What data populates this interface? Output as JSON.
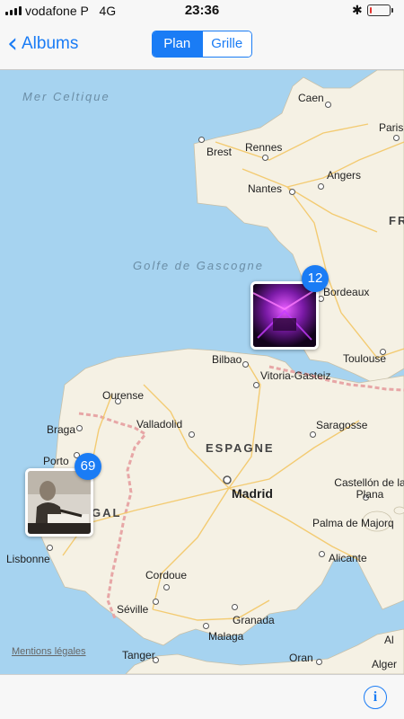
{
  "status_bar": {
    "carrier": "vodafone P",
    "network": "4G",
    "time": "23:36",
    "battery_level": 0.12,
    "battery_color": "#e5322d"
  },
  "nav": {
    "back_label": "Albums",
    "segments": [
      "Plan",
      "Grille"
    ],
    "selected_segment": "Plan",
    "accent_color": "#1a7cf5"
  },
  "map": {
    "seas": [
      "Mer Celtique",
      "Golfe de Gascogne"
    ],
    "countries": [
      "ESPAGNE",
      "FR",
      "GAL"
    ],
    "cities": [
      "Caen",
      "Paris",
      "Brest",
      "Rennes",
      "Nantes",
      "Angers",
      "Bordeaux",
      "Toulouse",
      "Bilbao",
      "Vitoria-Gasteiz",
      "Ourense",
      "Braga",
      "Porto",
      "Valladolid",
      "Saragosse",
      "Madrid",
      "Castellón de la Plana",
      "Palma de Majorq",
      "Lisbonne",
      "Alicante",
      "Cordoue",
      "Séville",
      "Granada",
      "Malaga",
      "Tanger",
      "Oran",
      "Al",
      "Alger"
    ],
    "legal_link": "Mentions légales"
  },
  "clusters": [
    {
      "count": "12",
      "thumbnail": "purple concert lights photo"
    },
    {
      "count": "69",
      "thumbnail": "man writing at desk photo"
    }
  ],
  "toolbar": {
    "info_icon": "ⓘ"
  }
}
